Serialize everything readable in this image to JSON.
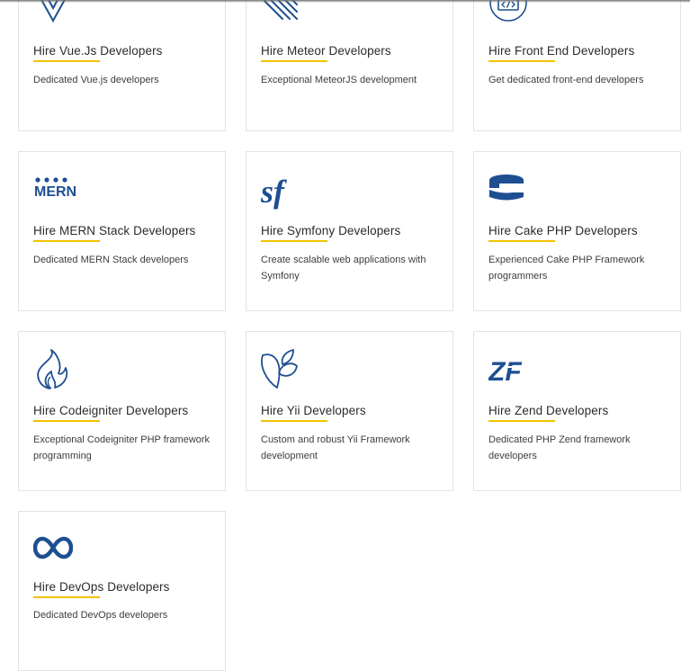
{
  "colors": {
    "icon_blue": "#1d4f91",
    "accent_underline": "#f2c200",
    "card_border": "#e3e3e3"
  },
  "cards": [
    {
      "icon": "vuejs-icon",
      "title": "Hire Vue.Js Developers",
      "desc": "Dedicated Vue.js developers"
    },
    {
      "icon": "meteor-icon",
      "title": "Hire Meteor Developers",
      "desc": "Exceptional MeteorJS development"
    },
    {
      "icon": "code-browser-icon",
      "title": "Hire Front End Developers",
      "desc": "Get dedicated front-end developers"
    },
    {
      "icon": "mern-icon",
      "icon_text": "MERN",
      "title": "Hire MERN Stack Developers",
      "desc": "Dedicated MERN Stack developers"
    },
    {
      "icon": "symfony-icon",
      "icon_text": "sf",
      "title": "Hire Symfony Developers",
      "desc": "Create scalable web applications with Symfony"
    },
    {
      "icon": "cakephp-icon",
      "title": "Hire Cake PHP Developers",
      "desc": "Experienced Cake PHP Framework programmers"
    },
    {
      "icon": "codeigniter-flame-icon",
      "title": "Hire Codeigniter Developers",
      "desc": "Exceptional Codeigniter PHP framework programming"
    },
    {
      "icon": "yii-leaf-icon",
      "title": "Hire Yii Developers",
      "desc": "Custom and robust Yii Framework development"
    },
    {
      "icon": "zend-icon",
      "icon_text": "ZF",
      "title": "Hire Zend Developers",
      "desc": "Dedicated PHP Zend framework developers"
    },
    {
      "icon": "infinity-devops-icon",
      "title": "Hire DevOps Developers",
      "desc": "Dedicated DevOps developers"
    }
  ]
}
